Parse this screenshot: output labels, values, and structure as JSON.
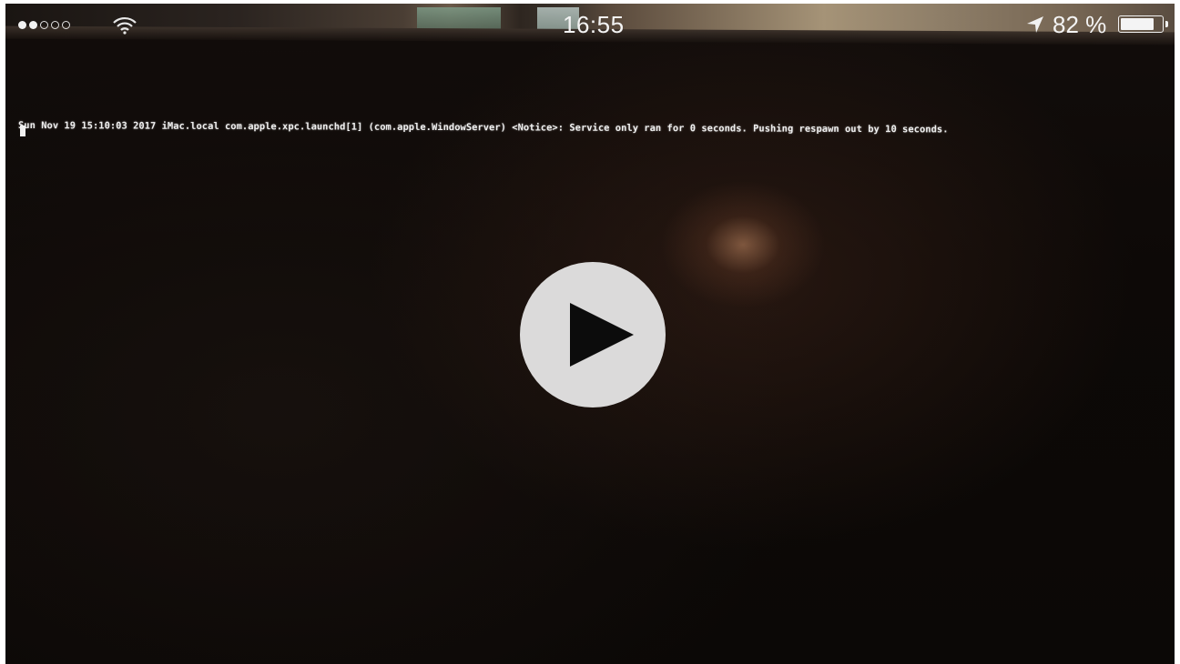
{
  "status_bar": {
    "signal_dots": 5,
    "signal_filled": 2,
    "time": "16:55",
    "location_icon": "location-arrow-icon",
    "battery_percent": "82 %",
    "battery_level": 0.82
  },
  "video": {
    "console_text": "Sun Nov 19 15:10:03 2017 iMac.local com.apple.xpc.launchd[1] (com.apple.WindowServer) <Notice>: Service only ran for 0 seconds. Pushing respawn out by 10 seconds.",
    "play_icon": "play-icon"
  }
}
